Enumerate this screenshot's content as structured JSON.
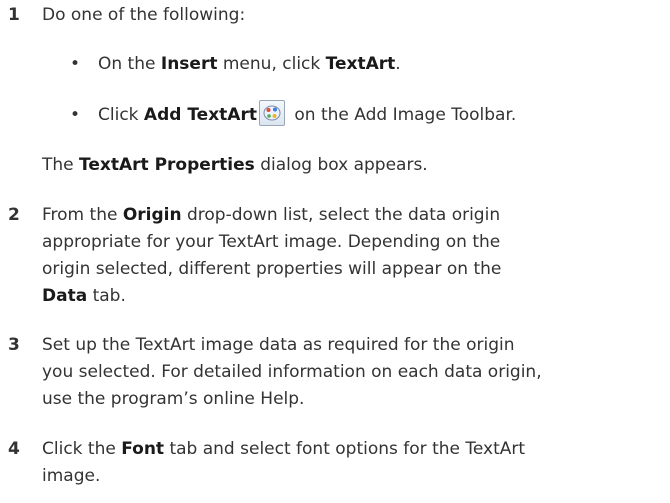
{
  "steps": [
    {
      "num": "1",
      "text": "Do one of the following:"
    },
    {
      "num": "2"
    },
    {
      "num": "3"
    },
    {
      "num": "4"
    }
  ],
  "step1": {
    "bullet1": {
      "pre": "On the ",
      "b1": "Insert",
      "mid": " menu, click ",
      "b2": "TextArt",
      "post": "."
    },
    "bullet2": {
      "pre": "Click ",
      "b1": "Add TextArt",
      "post": " on the Add Image Toolbar."
    },
    "result": {
      "pre": "The ",
      "b1": "TextArt Properties",
      "post": " dialog box appears."
    },
    "icon": "textart-icon"
  },
  "step2": {
    "l1_pre": "From the ",
    "l1_b": "Origin",
    "l1_post": " drop-down list, select the data origin",
    "l2": "appropriate for your TextArt image. Depending on the",
    "l3": "origin selected, different properties will appear on the",
    "l4_b": "Data",
    "l4_post": " tab."
  },
  "step3": {
    "l1": "Set up the TextArt image data as required for the origin",
    "l2": "you selected. For detailed information on each data origin,",
    "l3": "use the program’s online Help."
  },
  "step4": {
    "l1_pre": "Click the ",
    "l1_b": "Font",
    "l1_post": " tab and select font options for the TextArt",
    "l2": "image."
  },
  "bullet_glyph": "•"
}
